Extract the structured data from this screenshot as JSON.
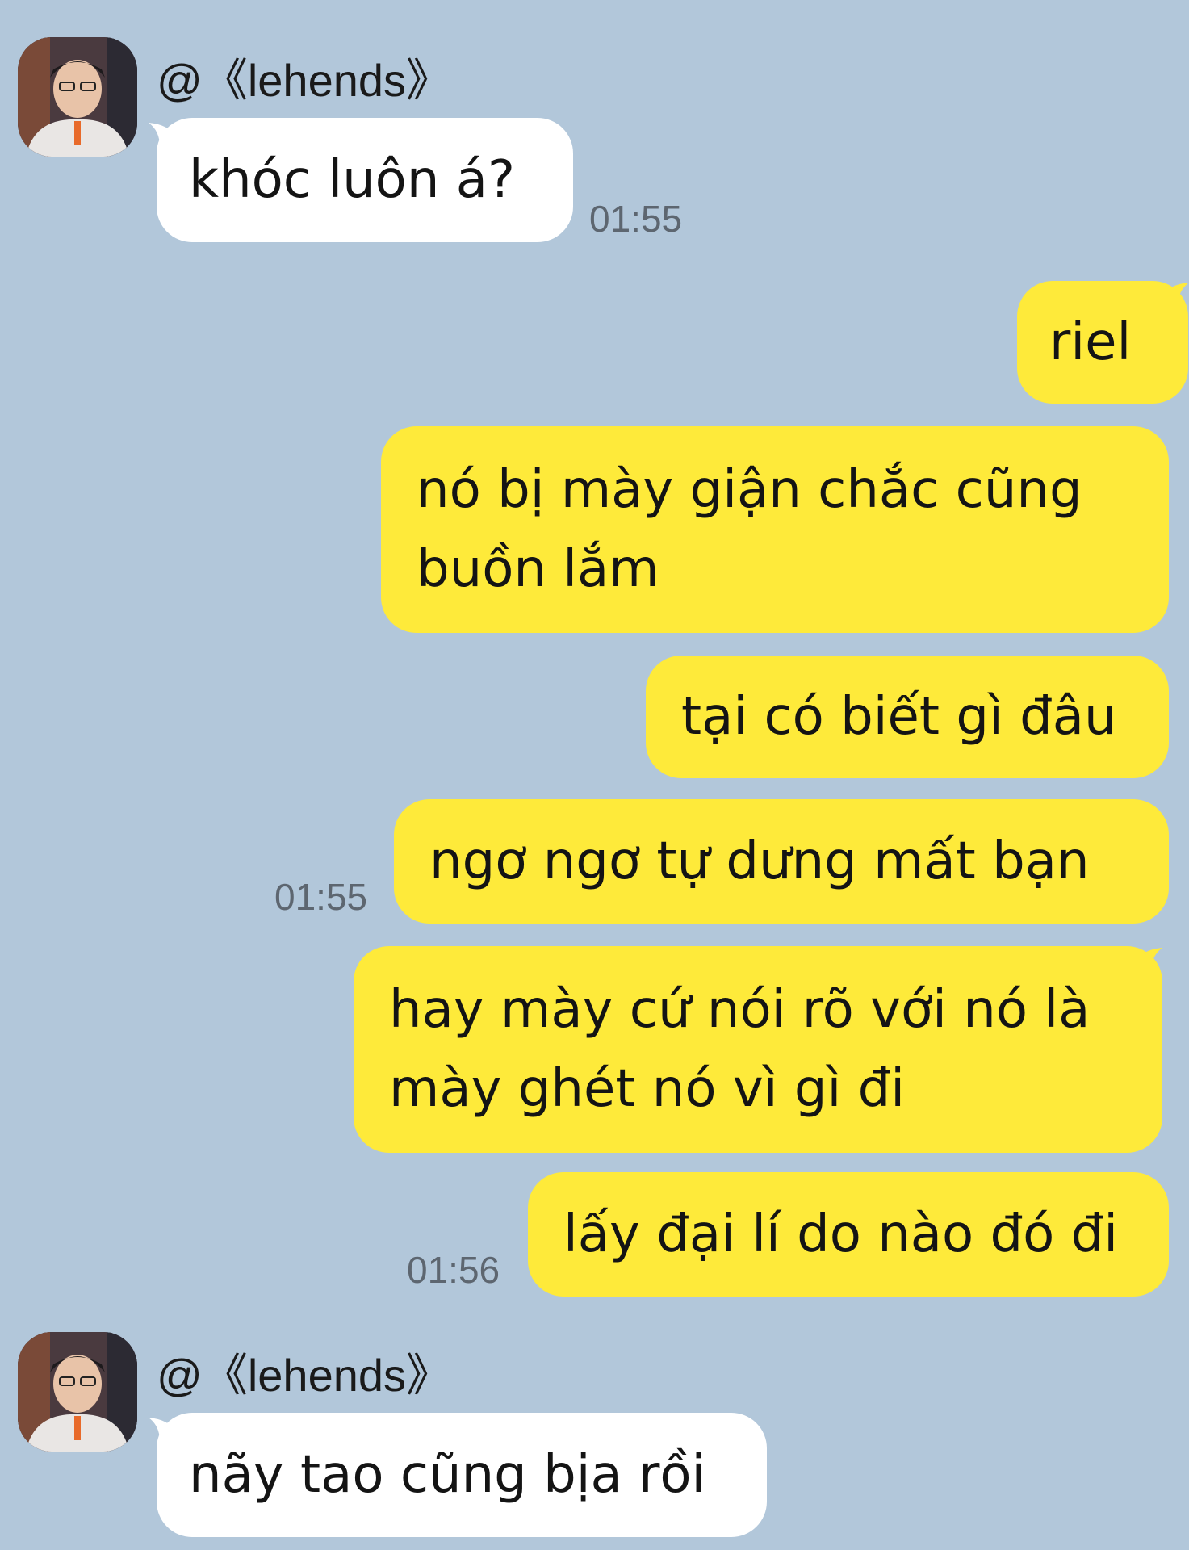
{
  "colors": {
    "background": "#b2c7da",
    "incoming_bubble": "#ffffff",
    "outgoing_bubble": "#feea3a",
    "timestamp": "#5d6670"
  },
  "messages": [
    {
      "sender": "@《lehends》",
      "avatar_icon": "user-avatar-icon",
      "text": "khóc luôn á?",
      "time": "01:55"
    },
    {
      "text": "riel"
    },
    {
      "text": "nó bị mày giận chắc cũng\nbuồn lắm"
    },
    {
      "text": "tại có biết gì đâu"
    },
    {
      "text": "ngơ ngơ tự dưng mất bạn",
      "time": "01:55"
    },
    {
      "text": "hay mày cứ nói rõ với nó là\nmày ghét nó vì gì đi"
    },
    {
      "text": "lấy đại lí do nào đó đi",
      "time": "01:56"
    },
    {
      "sender": "@《lehends》",
      "avatar_icon": "user-avatar-icon",
      "text": "nãy tao cũng bịa rồi"
    }
  ]
}
